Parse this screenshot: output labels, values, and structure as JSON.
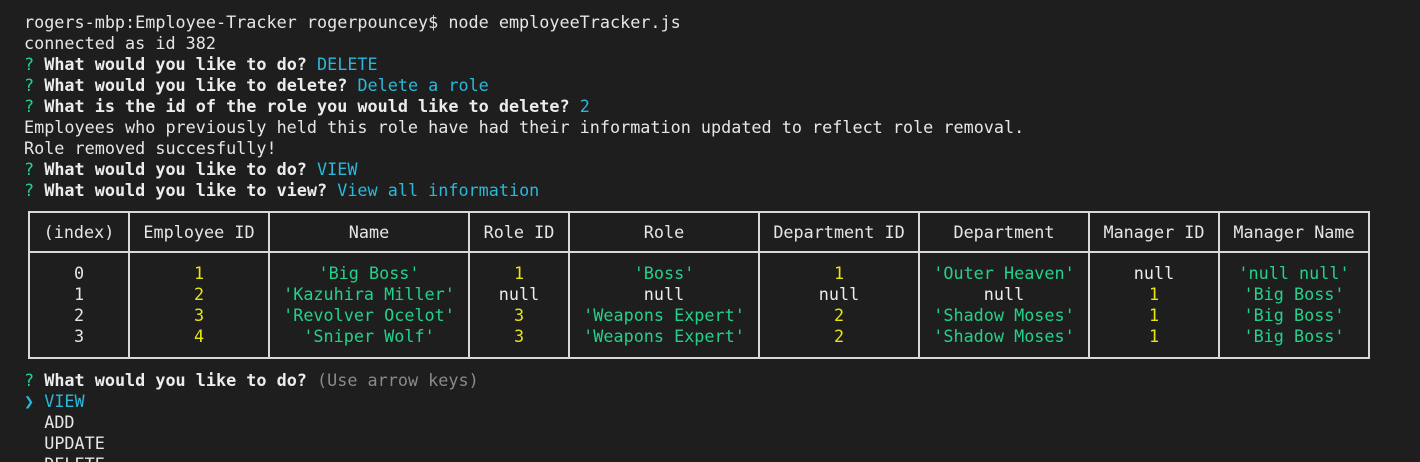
{
  "terminal": {
    "prompt_line": "rogers-mbp:Employee-Tracker rogerpouncey$ node employeeTracker.js",
    "connected": "connected as id 382",
    "q_mark": "?",
    "q1": {
      "question": "What would you like to do?",
      "answer": "DELETE"
    },
    "q2": {
      "question": "What would you like to delete?",
      "answer": "Delete a role"
    },
    "q3": {
      "question": "What is the id of the role you would like to delete?",
      "answer": "2"
    },
    "msg1": "Employees who previously held this role have had their information updated to reflect role removal.",
    "msg2": "Role removed succesfully!",
    "q4": {
      "question": "What would you like to do?",
      "answer": "VIEW"
    },
    "q5": {
      "question": "What would you like to view?",
      "answer": "View all information"
    },
    "table": {
      "headers": [
        "(index)",
        "Employee ID",
        "Name",
        "Role ID",
        "Role",
        "Department ID",
        "Department",
        "Manager ID",
        "Manager Name"
      ],
      "rows": [
        [
          "0",
          "1",
          "'Big Boss'",
          "1",
          "'Boss'",
          "1",
          "'Outer Heaven'",
          "null",
          "'null null'"
        ],
        [
          "1",
          "2",
          "'Kazuhira Miller'",
          "null",
          "null",
          "null",
          "null",
          "1",
          "'Big Boss'"
        ],
        [
          "2",
          "3",
          "'Revolver Ocelot'",
          "3",
          "'Weapons Expert'",
          "2",
          "'Shadow Moses'",
          "1",
          "'Big Boss'"
        ],
        [
          "3",
          "4",
          "'Sniper Wolf'",
          "3",
          "'Weapons Expert'",
          "2",
          "'Shadow Moses'",
          "1",
          "'Big Boss'"
        ]
      ]
    },
    "q6": {
      "question": "What would you like to do?",
      "hint": "(Use arrow keys)"
    },
    "menu": {
      "pointer": "❯",
      "items": [
        "VIEW",
        "ADD",
        "UPDATE",
        "DELETE"
      ],
      "selected": "VIEW"
    }
  },
  "colors": {
    "background": "#1e1e1e",
    "text": "#e6e6e6",
    "question_mark": "#23d18b",
    "answer": "#29b8db",
    "number": "#e5e510",
    "string": "#23d18b",
    "hint": "#8a8a8a"
  }
}
